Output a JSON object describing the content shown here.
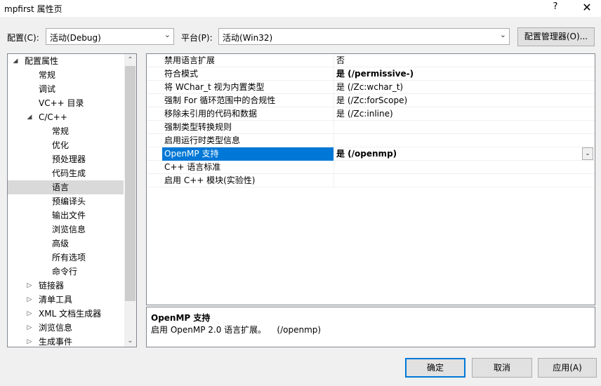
{
  "window": {
    "title": "mpfirst 属性页",
    "help": "?",
    "close": "✕"
  },
  "toolbar": {
    "config_label": "配置(C):",
    "config_value": "活动(Debug)",
    "platform_label": "平台(P):",
    "platform_value": "活动(Win32)",
    "config_manager_label": "配置管理器(O)..."
  },
  "tree": {
    "items": [
      {
        "label": "配置属性",
        "toggle": "◢"
      },
      {
        "label": "常规",
        "toggle": ""
      },
      {
        "label": "调试",
        "toggle": ""
      },
      {
        "label": "VC++ 目录",
        "toggle": ""
      },
      {
        "label": "C/C++",
        "toggle": "◢"
      },
      {
        "label": "常规",
        "toggle": ""
      },
      {
        "label": "优化",
        "toggle": ""
      },
      {
        "label": "预处理器",
        "toggle": ""
      },
      {
        "label": "代码生成",
        "toggle": ""
      },
      {
        "label": "语言",
        "toggle": ""
      },
      {
        "label": "预编译头",
        "toggle": ""
      },
      {
        "label": "输出文件",
        "toggle": ""
      },
      {
        "label": "浏览信息",
        "toggle": ""
      },
      {
        "label": "高级",
        "toggle": ""
      },
      {
        "label": "所有选项",
        "toggle": ""
      },
      {
        "label": "命令行",
        "toggle": ""
      },
      {
        "label": "链接器",
        "toggle": "▷"
      },
      {
        "label": "清单工具",
        "toggle": "▷"
      },
      {
        "label": "XML 文档生成器",
        "toggle": "▷"
      },
      {
        "label": "浏览信息",
        "toggle": "▷"
      },
      {
        "label": "生成事件",
        "toggle": "▷"
      }
    ]
  },
  "grid": {
    "rows": [
      {
        "name": "禁用语言扩展",
        "value": "否"
      },
      {
        "name": "符合模式",
        "value": "是 (/permissive-)"
      },
      {
        "name": "将 WChar_t 视为内置类型",
        "value": "是 (/Zc:wchar_t)"
      },
      {
        "name": "强制 For 循环范围中的合规性",
        "value": "是 (/Zc:forScope)"
      },
      {
        "name": "移除未引用的代码和数据",
        "value": "是 (/Zc:inline)"
      },
      {
        "name": "强制类型转换规则",
        "value": ""
      },
      {
        "name": "启用运行时类型信息",
        "value": ""
      },
      {
        "name": "OpenMP 支持",
        "value": "是 (/openmp)"
      },
      {
        "name": "C++ 语言标准",
        "value": ""
      },
      {
        "name": "启用 C++ 模块(实验性)",
        "value": ""
      }
    ]
  },
  "description": {
    "title": "OpenMP 支持",
    "text": "启用 OpenMP 2.0 语言扩展。    (/openmp)"
  },
  "buttons": {
    "ok": "确定",
    "cancel": "取消",
    "apply": "应用(A)"
  },
  "colors": {
    "selection": "#0078d7",
    "tree_selection": "#cce8ff"
  }
}
